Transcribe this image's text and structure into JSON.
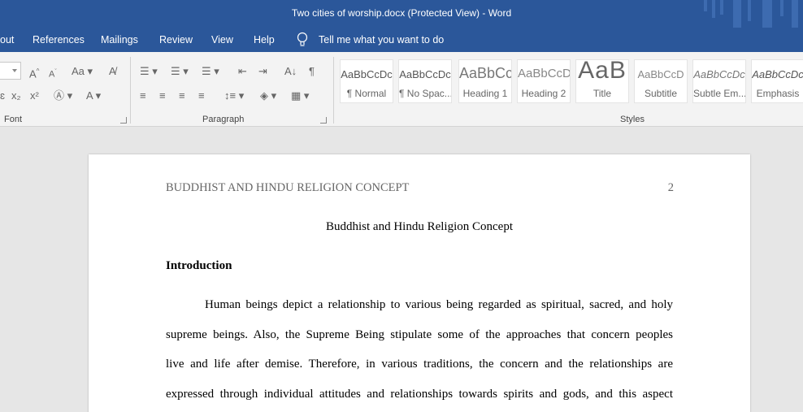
{
  "window": {
    "title": "Two cities of worship.docx (Protected View)  -  Word"
  },
  "tabs": {
    "items": [
      "out",
      "References",
      "Mailings",
      "Review",
      "View",
      "Help"
    ],
    "tell_me": "Tell me what you want to do"
  },
  "ribbon": {
    "groups": {
      "font": "Font",
      "paragraph": "Paragraph",
      "styles": "Styles"
    },
    "styles": [
      {
        "preview": "AaBbCcDc",
        "name": "¶ Normal"
      },
      {
        "preview": "AaBbCcDc",
        "name": "¶ No Spac..."
      },
      {
        "preview": "AaBbCc",
        "name": "Heading 1"
      },
      {
        "preview": "AaBbCcD",
        "name": "Heading 2"
      },
      {
        "preview": "AaB",
        "name": "Title"
      },
      {
        "preview": "AaBbCcD",
        "name": "Subtitle"
      },
      {
        "preview": "AaBbCcDc",
        "name": "Subtle Em..."
      },
      {
        "preview": "AaBbCcDc",
        "name": "Emphasis"
      }
    ]
  },
  "document": {
    "running_head": "BUDDHIST AND HINDU RELIGION CONCEPT",
    "page_number": "2",
    "title": "Buddhist and Hindu Religion Concept",
    "section_heading": "Introduction",
    "lines": [
      "Human beings depict a relationship to various being regarded as spiritual, sacred, and holy",
      "supreme beings. Also, the Supreme Being stipulate some of the approaches that concern peoples",
      "live and life after demise. Therefore, in various traditions, the concern and the relationships are",
      "expressed through individual attitudes and relationships towards spirits and gods, and this aspect"
    ]
  }
}
